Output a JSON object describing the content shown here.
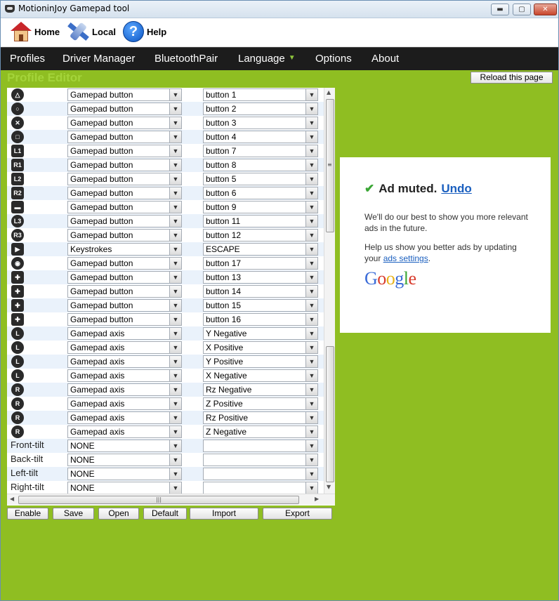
{
  "window": {
    "title": "MotioninJoy Gamepad tool",
    "controls": {
      "minimize": "▬",
      "maximize": "▢",
      "close": "✕"
    }
  },
  "toolbar": {
    "home": "Home",
    "local": "Local",
    "help": "Help",
    "help_glyph": "?"
  },
  "nav": {
    "profiles": "Profiles",
    "driver_manager": "Driver Manager",
    "bluetooth_pair": "BluetoothPair",
    "language": "Language",
    "options": "Options",
    "about": "About"
  },
  "editor": {
    "title": "Profile Editor",
    "reload": "Reload this page",
    "rows": [
      {
        "icon": "triangle-button-icon",
        "glyph": "△",
        "round": true,
        "type": "Gamepad button",
        "target": "button 1"
      },
      {
        "icon": "circle-button-icon",
        "glyph": "○",
        "round": true,
        "type": "Gamepad button",
        "target": "button 2"
      },
      {
        "icon": "cross-button-icon",
        "glyph": "✕",
        "round": true,
        "type": "Gamepad button",
        "target": "button 3"
      },
      {
        "icon": "square-button-icon",
        "glyph": "□",
        "round": true,
        "type": "Gamepad button",
        "target": "button 4"
      },
      {
        "icon": "l1-button-icon",
        "glyph": "L1",
        "round": false,
        "type": "Gamepad button",
        "target": "button 7"
      },
      {
        "icon": "r1-button-icon",
        "glyph": "R1",
        "round": false,
        "type": "Gamepad button",
        "target": "button 8"
      },
      {
        "icon": "l2-button-icon",
        "glyph": "L2",
        "round": false,
        "type": "Gamepad button",
        "target": "button 5"
      },
      {
        "icon": "r2-button-icon",
        "glyph": "R2",
        "round": false,
        "type": "Gamepad button",
        "target": "button 6"
      },
      {
        "icon": "select-button-icon",
        "glyph": "▬",
        "round": false,
        "type": "Gamepad button",
        "target": "button 9"
      },
      {
        "icon": "l3-button-icon",
        "glyph": "L3",
        "round": true,
        "type": "Gamepad button",
        "target": "button 11"
      },
      {
        "icon": "r3-button-icon",
        "glyph": "R3",
        "round": true,
        "type": "Gamepad button",
        "target": "button 12"
      },
      {
        "icon": "start-button-icon",
        "glyph": "▶",
        "round": false,
        "type": "Keystrokes",
        "target": "ESCAPE"
      },
      {
        "icon": "ps-button-icon",
        "glyph": "◉",
        "round": true,
        "type": "Gamepad button",
        "target": "button 17"
      },
      {
        "icon": "dpad-up-icon",
        "glyph": "✚",
        "round": false,
        "type": "Gamepad button",
        "target": "button 13"
      },
      {
        "icon": "dpad-right-icon",
        "glyph": "✚",
        "round": false,
        "type": "Gamepad button",
        "target": "button 14"
      },
      {
        "icon": "dpad-down-icon",
        "glyph": "✚",
        "round": false,
        "type": "Gamepad button",
        "target": "button 15"
      },
      {
        "icon": "dpad-left-icon",
        "glyph": "✚",
        "round": false,
        "type": "Gamepad button",
        "target": "button 16"
      },
      {
        "icon": "left-stick-up-icon",
        "glyph": "L",
        "round": true,
        "type": "Gamepad axis",
        "target": "Y Negative"
      },
      {
        "icon": "left-stick-right-icon",
        "glyph": "L",
        "round": true,
        "type": "Gamepad axis",
        "target": "X Positive"
      },
      {
        "icon": "left-stick-down-icon",
        "glyph": "L",
        "round": true,
        "type": "Gamepad axis",
        "target": "Y Positive"
      },
      {
        "icon": "left-stick-left-icon",
        "glyph": "L",
        "round": true,
        "type": "Gamepad axis",
        "target": "X Negative"
      },
      {
        "icon": "right-stick-up-icon",
        "glyph": "R",
        "round": true,
        "type": "Gamepad axis",
        "target": "Rz Negative"
      },
      {
        "icon": "right-stick-right-icon",
        "glyph": "R",
        "round": true,
        "type": "Gamepad axis",
        "target": "Z Positive"
      },
      {
        "icon": "right-stick-down-icon",
        "glyph": "R",
        "round": true,
        "type": "Gamepad axis",
        "target": "Rz Positive"
      },
      {
        "icon": "right-stick-left-icon",
        "glyph": "R",
        "round": true,
        "type": "Gamepad axis",
        "target": "Z Negative"
      },
      {
        "label": "Front-tilt",
        "type": "NONE",
        "target": ""
      },
      {
        "label": "Back-tilt",
        "type": "NONE",
        "target": ""
      },
      {
        "label": "Left-tilt",
        "type": "NONE",
        "target": ""
      },
      {
        "label": "Right-tilt",
        "type": "NONE",
        "target": ""
      }
    ],
    "dropdown_glyph": "▼",
    "scroll_glyphs": {
      "up": "▲",
      "down": "▼",
      "left": "◀",
      "right": "▶",
      "grip_v": "≡",
      "grip_h": "|||"
    }
  },
  "actions": {
    "enable": "Enable",
    "save": "Save",
    "open": "Open",
    "default": "Default",
    "import": "Import",
    "export": "Export"
  },
  "ad": {
    "check": "✔",
    "muted": "Ad muted.",
    "undo": "Undo",
    "p1": "We'll do our best to show you more relevant ads in the future.",
    "p2_prefix": "Help us show you better ads by updating your ",
    "p2_link": "ads settings",
    "p2_suffix": ".",
    "logo": [
      "G",
      "o",
      "o",
      "g",
      "l",
      "e"
    ]
  },
  "colors": {
    "content_bg": "#8fbe22",
    "nav_bg": "#1c1c1c",
    "title_green": "#a4d43a",
    "alt_row": "#eaf2fb"
  }
}
